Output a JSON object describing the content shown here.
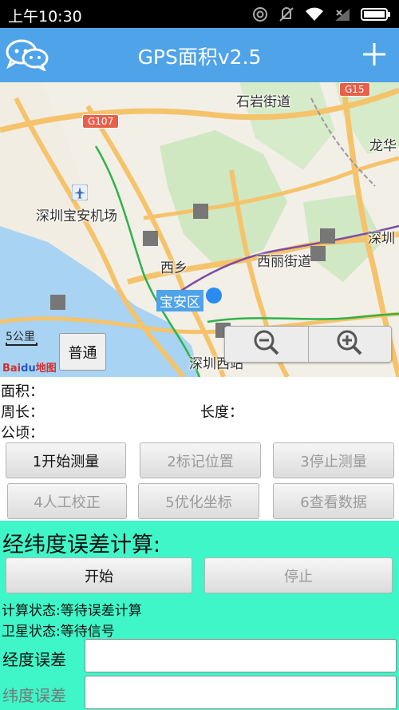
{
  "status_bar": {
    "time": "上午10:30",
    "icons": [
      "hotspot-icon",
      "mute-icon",
      "wifi-icon",
      "signal-icon",
      "battery-icon"
    ]
  },
  "title_bar": {
    "title": "GPS面积v2.5",
    "left_icon": "wechat-icon",
    "right_icon": "plus-icon"
  },
  "map": {
    "labels": {
      "shiyan": "石岩街道",
      "airport": "深圳宝安机场",
      "xixiang": "西乡",
      "xili": "西丽街道",
      "baoan": "宝安区",
      "longhua_partial": "龙华",
      "shenzhen_partial": "深圳",
      "shenzhen_west": "深圳西站",
      "g107": "G107",
      "g15": "G15"
    },
    "scale": "5公里",
    "logo": "Bai地图",
    "mode_button": "普通",
    "zoom_out_icon": "zoom-out-icon",
    "zoom_in_icon": "zoom-in-icon"
  },
  "info": {
    "area_label": "面积：",
    "perimeter_label": "周长：",
    "length_label": "长度：",
    "hectare_label": "公顷："
  },
  "buttons": {
    "start_measure": "1开始测量",
    "mark_position": "2标记位置",
    "stop_measure": "3停止测量",
    "manual_correct": "4人工校正",
    "optimize_coords": "5优化坐标",
    "view_data": "6查看数据"
  },
  "calc": {
    "heading": "经纬度误差计算:",
    "start": "开始",
    "stop": "停止",
    "calc_status": "计算状态:等待误差计算",
    "satellite_status": "卫星状态:等待信号",
    "lon_error_label": "经度误差",
    "lat_error_label": "纬度误差",
    "lon_error_value": "",
    "lat_error_value": ""
  },
  "colors": {
    "status_bar": "#000000",
    "title_bar": "#4fa3e8",
    "calc_panel": "#3ff6c8",
    "accent_blue": "#2a8cf0"
  }
}
